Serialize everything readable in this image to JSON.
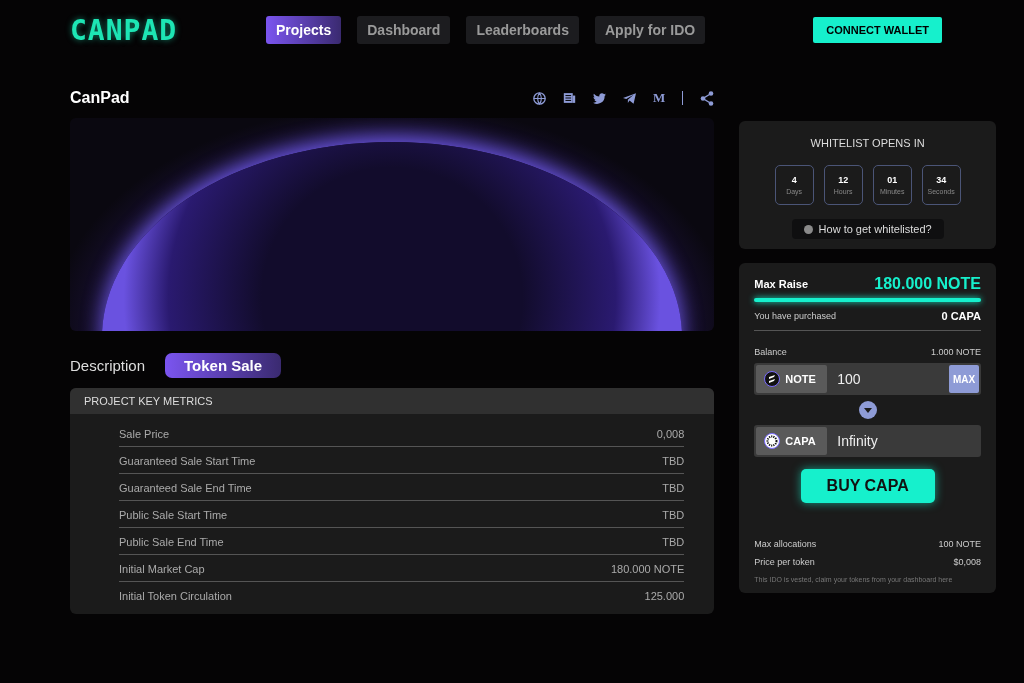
{
  "logo": "CANPAD",
  "nav": [
    {
      "label": "Projects",
      "selected": true
    },
    {
      "label": "Dashboard",
      "selected": false
    },
    {
      "label": "Leaderboards",
      "selected": false
    },
    {
      "label": "Apply for IDO",
      "selected": false
    }
  ],
  "connect_button": "CONNECT WALLET",
  "project": {
    "title": "CanPad",
    "social_links": [
      {
        "kind": "globe"
      },
      {
        "kind": "document"
      },
      {
        "kind": "bird"
      },
      {
        "kind": "plane"
      },
      {
        "kind": "text",
        "label": "M"
      },
      {
        "kind": "divider"
      },
      {
        "kind": "share"
      }
    ]
  },
  "tabs": [
    {
      "label": "Description",
      "selected": false
    },
    {
      "label": "Token Sale",
      "selected": true
    }
  ],
  "metrics": {
    "title": "PROJECT KEY METRICS",
    "rows": [
      {
        "label": "Sale Price",
        "value": "0,008"
      },
      {
        "label": "Guaranteed Sale Start Time",
        "value": "TBD"
      },
      {
        "label": "Guaranteed Sale End Time",
        "value": "TBD"
      },
      {
        "label": "Public Sale Start Time",
        "value": "TBD"
      },
      {
        "label": "Public Sale End Time",
        "value": "TBD"
      },
      {
        "label": "Initial Market Cap",
        "value": "180.000 NOTE"
      },
      {
        "label": "Initial Token Circulation",
        "value": "125.000"
      }
    ]
  },
  "countdown": {
    "title": "WHITELIST OPENS IN",
    "units": [
      {
        "value": "4",
        "label": "Days"
      },
      {
        "value": "12",
        "label": "Hours"
      },
      {
        "value": "01",
        "label": "Minutes"
      },
      {
        "value": "34",
        "label": "Seconds"
      }
    ],
    "help": "How to get whitelisted?"
  },
  "sale": {
    "max_raise_label": "Max Raise",
    "max_raise": "180.000 NOTE",
    "level": 1,
    "purchased_label": "You have purchased",
    "purchased": "0 CAPA",
    "balance_label": "Balance",
    "balance": "1.000 NOTE",
    "from_token": "NOTE",
    "from_value": "100",
    "max_button": "MAX",
    "to_token": "CAPA",
    "to_value": "Infinity",
    "buy_button": "BUY CAPA",
    "details": [
      {
        "label": "Max allocations",
        "value": "100 NOTE"
      },
      {
        "label": "Price per token",
        "value": "$0,008"
      }
    ],
    "note": "This IDO is vested, claim your tokens from your dashboard here"
  }
}
